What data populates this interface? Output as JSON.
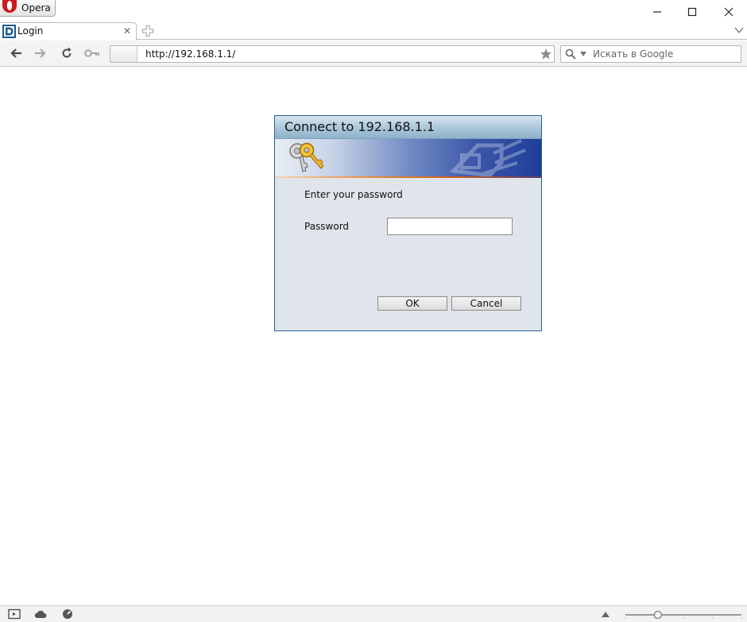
{
  "browser": {
    "menu_button_label": "Opera",
    "window_controls": [
      "minimize-icon",
      "maximize-icon",
      "close-icon"
    ]
  },
  "tabs": [
    {
      "title": "Login",
      "favicon": "dlink-logo-icon",
      "active": true
    }
  ],
  "navigation": {
    "address": "http://192.168.1.1/",
    "search_placeholder": "Искать в Google"
  },
  "dialog": {
    "title": "Connect to 192.168.1.1",
    "prompt": "Enter your password",
    "password_label": "Password",
    "password_value": "",
    "ok_label": "OK",
    "cancel_label": "Cancel"
  },
  "statusbar": {
    "icons": [
      "panel-toggle-icon",
      "cloud-icon",
      "speed-dial-icon",
      "zoom-icon"
    ],
    "zoom_fraction": 0.28
  },
  "colors": {
    "dialog_border": "#2a5f93",
    "dialog_background": "#dfe5ea",
    "opera_red": "#cc1b1b"
  }
}
